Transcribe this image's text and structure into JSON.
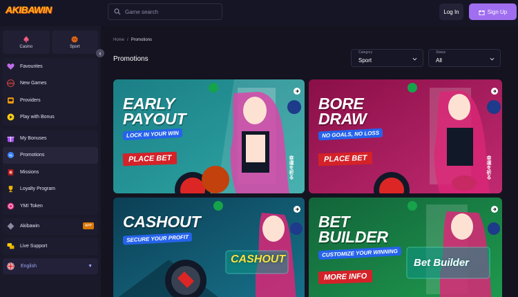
{
  "header": {
    "logo_text": "AKIBAWIN",
    "search_placeholder": "Game search",
    "login_label": "Log In",
    "signup_label": "Sign Up"
  },
  "sidebar": {
    "modes": [
      {
        "label": "Casino",
        "icon": "spade-icon"
      },
      {
        "label": "Sport",
        "icon": "basketball-icon"
      }
    ],
    "group1": [
      {
        "label": "Favourites",
        "icon": "heart-icon"
      },
      {
        "label": "New Games",
        "icon": "new-badge-icon"
      },
      {
        "label": "Providers",
        "icon": "slot-machine-icon"
      },
      {
        "label": "Play with Bonus",
        "icon": "play-icon"
      }
    ],
    "group2": [
      {
        "label": "My Bonuses",
        "icon": "gift-icon"
      },
      {
        "label": "Promotions",
        "icon": "percent-gear-icon"
      },
      {
        "label": "Missions",
        "icon": "missions-icon"
      },
      {
        "label": "Loyalty Program",
        "icon": "trophy-icon"
      },
      {
        "label": "YMI Token",
        "icon": "token-icon"
      }
    ],
    "akibawin_label": "Akibawin",
    "akibawin_badge": "APP",
    "support_label": "Live Support",
    "language": "English"
  },
  "main": {
    "breadcrumb": [
      "Home",
      "Promotions"
    ],
    "title": "Promotions",
    "filters": {
      "category": {
        "label": "Category",
        "value": "Sport"
      },
      "status": {
        "label": "Status",
        "value": "All"
      }
    },
    "cards": [
      {
        "heading_1": "EARLY",
        "heading_2": "PAYOUT",
        "tagline": "LOCK IN YOUR WIN",
        "cta": "PLACE BET",
        "side_text": "幸運を祈る",
        "bg1": "#1b7f86",
        "bg2": "#2fa7a5"
      },
      {
        "heading_1": "BORE",
        "heading_2": "DRAW",
        "tagline": "NO GOALS, NO LOSS",
        "cta": "PLACE BET",
        "side_text": "幸運を祈る",
        "bg1": "#8a0f48",
        "bg2": "#c02a70"
      },
      {
        "heading_1": "CASHOUT",
        "heading_2": "",
        "tagline": "SECURE YOUR PROFIT",
        "cta": "",
        "badge": "CASHOUT",
        "bg1": "#0c3f55",
        "bg2": "#17728a"
      },
      {
        "heading_1": "BET",
        "heading_2": "BUILDER",
        "tagline": "CUSTOMIZE YOUR WINNING",
        "cta": "MORE INFO",
        "badge": "Bet Builder",
        "bg1": "#12643a",
        "bg2": "#1f9a4e"
      }
    ]
  },
  "colors": {
    "accent": "#a06ef0",
    "cta_red": "#d42229",
    "tag_blue": "#2563eb",
    "sidebar_bg": "#1a1929"
  }
}
